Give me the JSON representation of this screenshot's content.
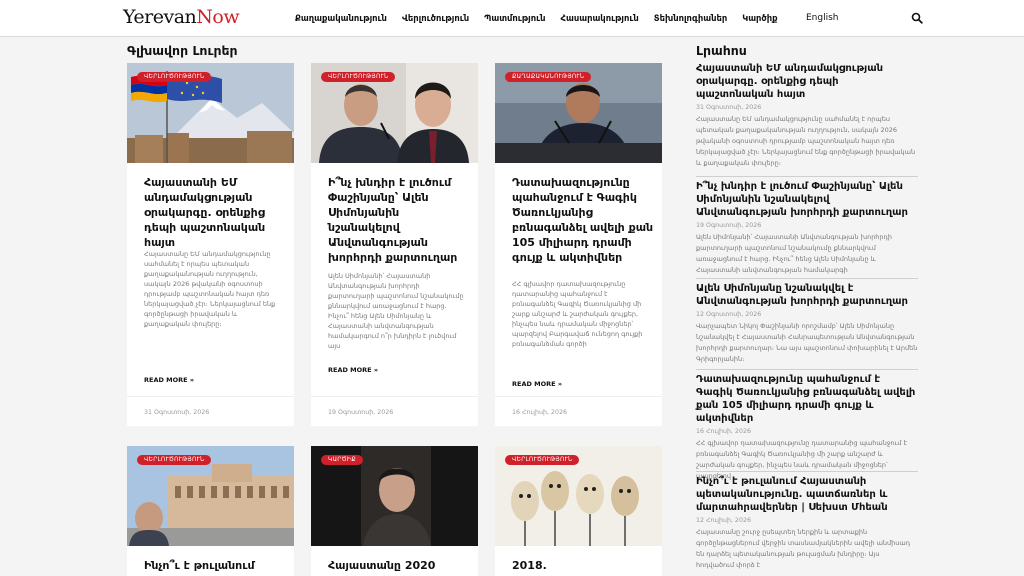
{
  "header": {
    "logo_part1": "Yerevan",
    "logo_part2": "Now",
    "nav": [
      "Քաղաքականություն",
      "Վերլուծություն",
      "Պատմություն",
      "Հասարակություն",
      "Տեխնոլոգիաներ",
      "Կարծիք"
    ],
    "language": "English"
  },
  "main": {
    "section_title": "Գլխավոր Լուրեր",
    "cards": [
      {
        "badge": "ՎԵՐԼՈՒԾՈՒԹՅՈՒՆ",
        "title": "Հայաստանի ԵՄ անդամակցության օրակարգը. օրենքից դեպի պաշտոնական հայտ",
        "excerpt": "Հայաստանը ԵՄ անդամակցությունը սահմանել է որպես պետական քաղաքականության ուղղություն, սակայն 2026 թվականի օգոստոսի դրությամբ պաշտոնական հայտ դեռ ներկայացված չէր։ Ներկայացնում ենք գործընթացի իրավական և քաղաքական փուլերը։",
        "read_more": "READ MORE »",
        "date": "31 Օգոստոսի, 2026"
      },
      {
        "badge": "ՎԵՐԼՈՒԾՈՒԹՅՈՒՆ",
        "title": "Ի՞նչ խնդիր է լուծում Փաշինյանը՝ Ալեն Սիմոնյանին նշանակելով Անվտանգության խորհրդի քարտուղար",
        "excerpt": "Ալեն Սիմոնյանի՝ Հայաստանի Անվտանգության խորհրդի քարտուղարի պաշտոնում նշանակումը քննարկվում առաջացնում է հարց. Ինչու՞ հենց Ալեն Սիմոնյանը և Հայաստանի անվտանգության համակարգում ո՞ր խնդիրն է լուծվում այս",
        "read_more": "READ MORE »",
        "date": "19 Օգոստոսի, 2026"
      },
      {
        "badge": "ՔԱՂԱՔԱԿԱՆՈՒԹՅՈՒՆ",
        "title": "Դատախազությունը պահանջում է Գագիկ Ծառուկյանից բռնագանձել ավելի քան 105 միլիարդ դրամի գույք և ակտիվներ",
        "excerpt": "ՀՀ գլխավոր դատախազությունը դատարանից պահանջում է բռնագանձել Գագիկ Ծառուկյանից մի շարք անշարժ և շարժական գույքեր, ինչպես նաև դրամական միջոցներ՝ պարզելով Բարգավաճ ունեցող գույքի բռնագանձման գործի",
        "read_more": "READ MORE »",
        "date": "16 Հուլիսի, 2026"
      },
      {
        "badge": "ՎԵՐԼՈՒԾՈՒԹՅՈՒՆ",
        "title": "Ինչո՞ւ է թուլանում Հայաստանի"
      },
      {
        "badge": "ԿԱՐԾԻՔ",
        "title": "Հայաստանը 2020"
      },
      {
        "badge": "ՎԵՐԼՈՒԾՈՒԹՅՈՒՆ",
        "title": "2018."
      }
    ]
  },
  "sidebar": {
    "title": "Լրահոս",
    "items": [
      {
        "title": "Հայաստանի ԵՄ անդամակցության օրակարգը. օրենքից դեպի պաշտոնական հայտ",
        "date": "31 Օգոստոսի, 2026",
        "excerpt": "Հայաստանը ԵՄ անդամակցությունը սահմանել է որպես պետական քաղաքականության ուղղություն, սակայն 2026 թվականի օգոստոսի դրությամբ պաշտոնական հայտ դեռ ներկայացված չէր։ Ներկայացնում ենք գործընթացի իրավական և քաղաքական փուլերը։"
      },
      {
        "title": "Ի՞նչ խնդիր է լուծում Փաշինյանը՝ Ալեն Սիմոնյանին նշանակելով Անվտանգության խորհրդի քարտուղար",
        "date": "19 Օգոստոսի, 2026",
        "excerpt": "Ալեն Սիմոնյանի՝ Հայաստանի Անվտանգության խորհրդի քարտուղարի պաշտոնում նշանակումը քննարկվում առաջացնում է հարց. Ինչու՞ հենց Ալեն Սիմոնյանը և Հայաստանի անվտանգության համակարգի"
      },
      {
        "title": "Ալեն Սիմոնյանը նշանակվել է Անվտանգության խորհրդի քարտուղար",
        "date": "12 Օգոստոսի, 2026",
        "excerpt": "Վարչապետ Նիկոլ Փաշինյանի որոշմամբ՝ Ալեն Սիմոնյանը նշանակվել է Հայաստանի Հանրապետության Անվտանգության խորհրդի քարտուղար։ Նա այս պաշտոնում փոխարինել է Արմեն Գրիգորյանին։"
      },
      {
        "title": "Դատախազությունը պահանջում է Գագիկ Ծառուկյանից բռնագանձել ավելի քան 105 միլիարդ դրամի գույք և ակտիվներ",
        "date": "16 Հուլիսի, 2026",
        "excerpt": "ՀՀ գլխավոր դատախազությունը դատարանից պահանջում է բռնագանձել Գագիկ Ծառուկյանից մի շարք անշարժ և շարժական գույքեր, ինչպես նաև դրամական միջոցներ՝ պարզելով"
      },
      {
        "title": "Ինչո՞ւ է թուլանում Հայաստանի պետականությունը. պատճառներ և մարտահրավերներ | Սեխստ Մհեան",
        "date": "12 Հուլիսի, 2026",
        "excerpt": "Հայաստանը շուրջ ըսեպտեղ ներքին և արտաքին գործընթացներում վերջին տասնամյակներին ավելի անմիսադ են դարձել պետականության թուլացման խնդիրը։ Այս հոդվածում փորձ է"
      }
    ]
  },
  "colors": {
    "accent": "#d0202a",
    "text": "#111111",
    "muted": "#777777",
    "background": "#f4f4f4"
  }
}
